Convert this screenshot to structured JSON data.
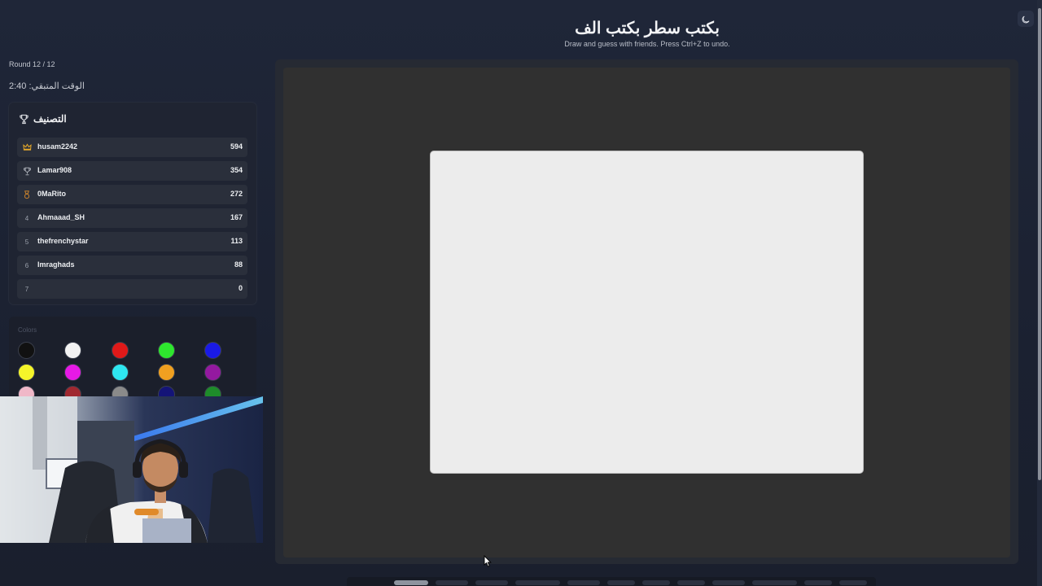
{
  "header": {
    "title": "بكتب سطر بكتب الف",
    "subtitle": "Draw and guess with friends. Press Ctrl+Z to undo."
  },
  "game": {
    "round": "Round 12 / 12",
    "time_remaining": "الوقت المتبقي: 2:40"
  },
  "leaderboard": {
    "title": "التصنيف",
    "players": [
      {
        "rank": "1",
        "icon": "crown-icon",
        "name": "husam2242",
        "score": "594"
      },
      {
        "rank": "2",
        "icon": "trophy-icon",
        "name": "Lamar908",
        "score": "354"
      },
      {
        "rank": "3",
        "icon": "medal-icon",
        "name": "0MaRito",
        "score": "272"
      },
      {
        "rank": "4",
        "name": "Ahmaaad_SH",
        "score": "167"
      },
      {
        "rank": "5",
        "name": "thefrenchystar",
        "score": "113"
      },
      {
        "rank": "6",
        "name": "Imraghads",
        "score": "88"
      },
      {
        "rank": "7",
        "name": "",
        "score": "0"
      }
    ]
  },
  "palette": {
    "label": "Colors",
    "colors": [
      "#111111",
      "#f2f2f2",
      "#e01919",
      "#2ee62e",
      "#1a1ae6",
      "#f5f52a",
      "#e619e6",
      "#2ee6f0",
      "#f0a020",
      "#9419a0",
      "#f0b8c8",
      "#a02830",
      "#8a8a8a",
      "#141478",
      "#1e8c2a"
    ]
  },
  "theme": {
    "toggle_icon": "moon-icon",
    "background": "#1c2333",
    "canvas_background": "#303030",
    "board_color": "#ececec"
  }
}
